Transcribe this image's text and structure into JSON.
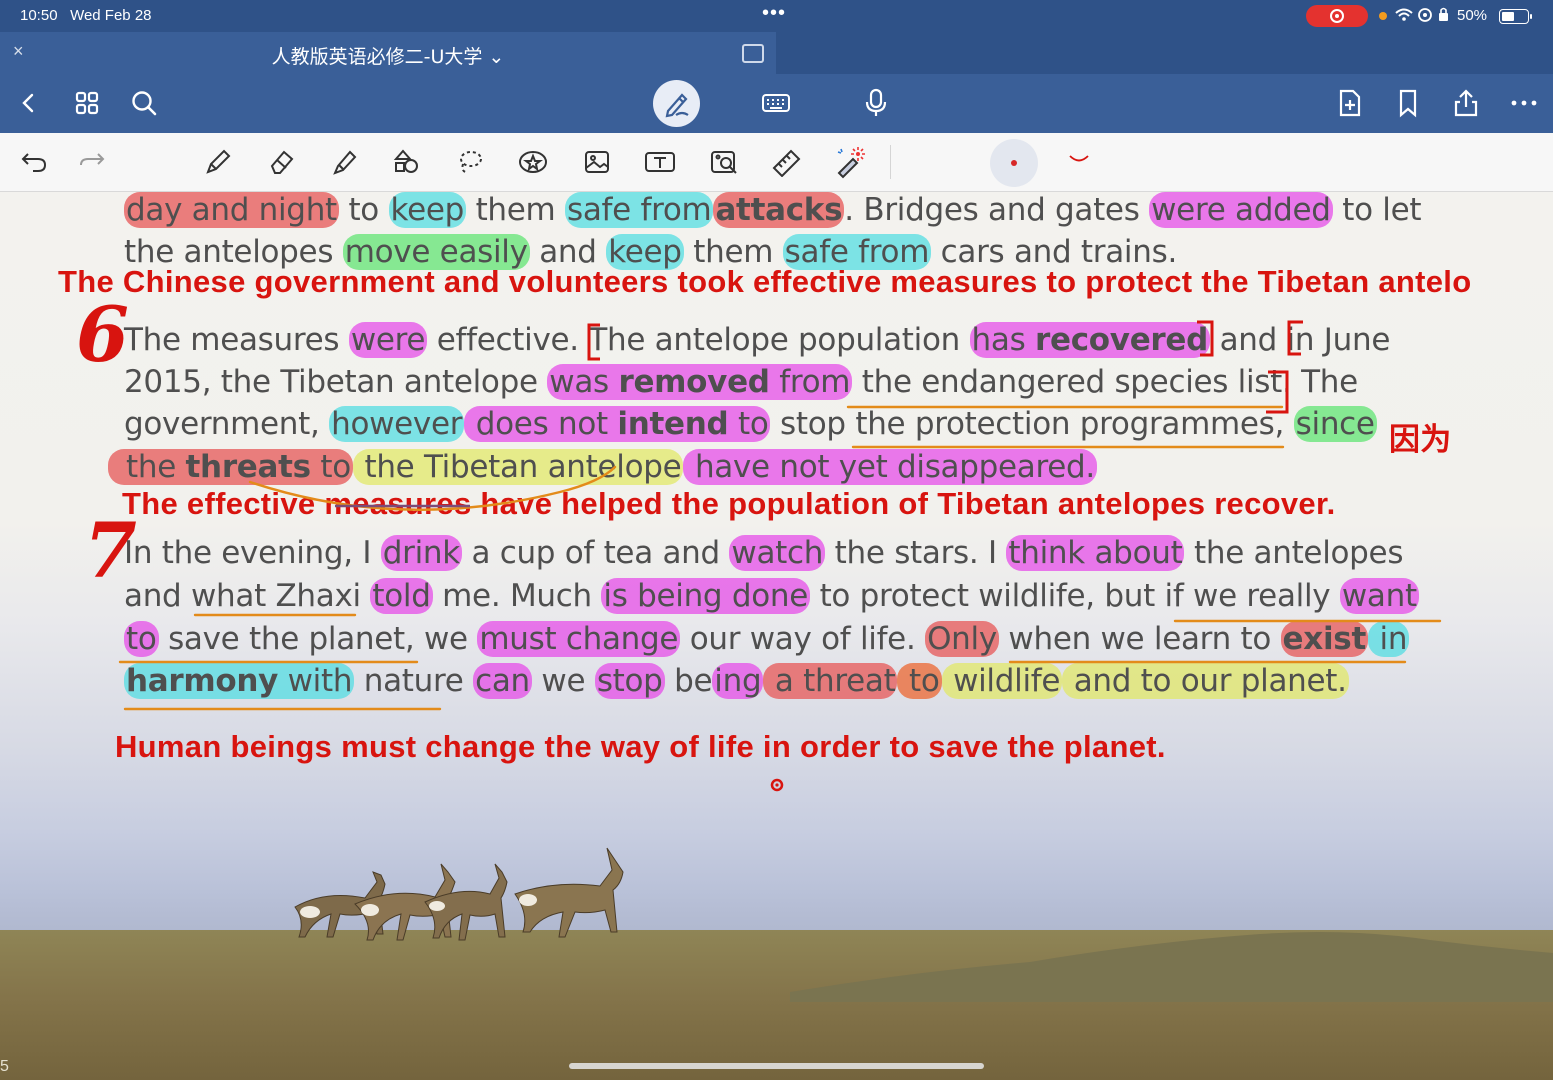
{
  "status": {
    "time": "10:50",
    "date": "Wed Feb 28",
    "dots": "•••",
    "battery": "50%",
    "icons": [
      "recording-icon",
      "wifi-icon",
      "location-icon",
      "lock-icon",
      "battery-icon"
    ]
  },
  "tab": {
    "close": "×",
    "title": "人教版英语必修二-U大学 ⌄"
  },
  "colors": {
    "navy": "#2f5288",
    "toolbar_blue": "#3a5f98",
    "annotation_red": "#d8140f",
    "highlight_pink": "#e54de8",
    "highlight_cyan": "#4edde2",
    "highlight_red": "#e75c5c",
    "highlight_green": "#67e678",
    "highlight_yellow": "#e1e860"
  },
  "text": {
    "l1": {
      "a": "day and night",
      "b": " to ",
      "c": "keep",
      "d": " them ",
      "e": "safe from",
      "f": "attacks",
      "g": ". Bridges and gates ",
      "h": "were added",
      "i": " to let"
    },
    "l2": {
      "a": "the antelopes ",
      "b": "move easily",
      "c": " and ",
      "d": "keep",
      "e": " them ",
      "f": "safe from",
      "g": " cars and trains."
    },
    "l3": {
      "a": "The measures ",
      "b": "were",
      "c": " effective. The antelope population ",
      "d": "has ",
      "e": "recovered",
      "f": " and in June"
    },
    "l4": {
      "a": "2015, the Tibetan antelope ",
      "b": "was ",
      "c": "removed",
      "d": " from",
      "e": " the endangered species list. The"
    },
    "l5": {
      "a": "government, ",
      "b": "however",
      "c": " does not ",
      "d": "intend",
      "e": " to",
      "f": " stop ",
      "g": "the protection programmes",
      "h": ", ",
      "i": "since"
    },
    "l6": {
      "a": "the ",
      "b": "threats",
      "c": " to",
      "d": " the Tibetan antelope",
      "e": " have not yet disappeared."
    },
    "l7": {
      "a": "In the evening, I ",
      "b": "drink",
      "c": " a cup of tea and ",
      "d": "watch",
      "e": " the stars. I ",
      "f": "think about",
      "g": " the antelopes"
    },
    "l8": {
      "a": "and what Zhaxi ",
      "b": "told",
      "c": " me. Much ",
      "d": "is being done",
      "e": " to protect wildlife, but if we really ",
      "f": "want"
    },
    "l9": {
      "a": "to",
      "b": " save the planet, we ",
      "c": "must change",
      "d": " our way of life. ",
      "e": "Only",
      "f": " when we learn to ",
      "g": "exist",
      "h": " in"
    },
    "l10": {
      "a": "harmony",
      "b": " with",
      "c": " nature ",
      "d": "can",
      "e": " we ",
      "f": "stop",
      "g": " be",
      "h": "ing",
      "i": " a threat",
      "j": " to",
      "k": " wildlife",
      "l": " and to our planet."
    }
  },
  "annotations": {
    "a1": "The Chinese government and volunteers took effective measures to protect the Tibetan antelo",
    "num6": "6",
    "a2": "因为",
    "a3": "The effective measures have helped the population of Tibetan antelopes recover.",
    "num7": "7",
    "a4": "Human beings must change the way of life in order to save the planet."
  },
  "page_edge_mark": "5"
}
